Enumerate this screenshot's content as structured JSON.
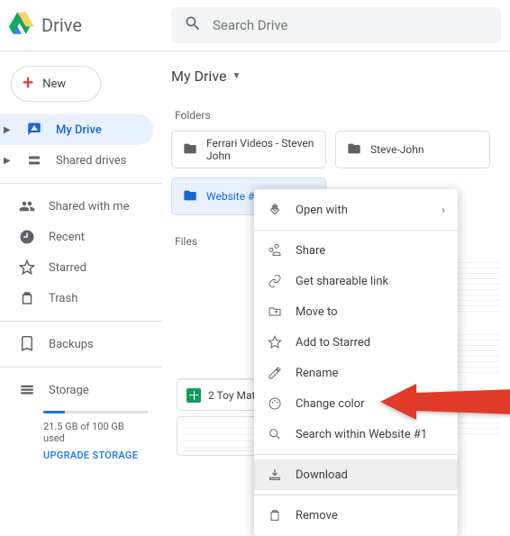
{
  "app_name": "Drive",
  "search": {
    "placeholder": "Search Drive"
  },
  "new_button": "New",
  "sidebar": {
    "items": [
      {
        "label": "My Drive"
      },
      {
        "label": "Shared drives"
      },
      {
        "label": "Shared with me"
      },
      {
        "label": "Recent"
      },
      {
        "label": "Starred"
      },
      {
        "label": "Trash"
      },
      {
        "label": "Backups"
      },
      {
        "label": "Storage"
      }
    ],
    "storage_used": "21.5 GB of 100 GB used",
    "upgrade": "UPGRADE STORAGE"
  },
  "breadcrumb": {
    "label": "My Drive"
  },
  "sections": {
    "folders_label": "Folders",
    "files_label": "Files"
  },
  "folders": [
    {
      "name": "Ferrari Videos - Steven John"
    },
    {
      "name": "Steve-John"
    },
    {
      "name": "Website #1"
    }
  ],
  "files": [
    {
      "name": "2 Toy Mat"
    }
  ],
  "context_menu": {
    "open_with": "Open with",
    "share": "Share",
    "get_link": "Get shareable link",
    "move_to": "Move to",
    "add_star": "Add to Starred",
    "rename": "Rename",
    "change_color": "Change color",
    "search_within": "Search within Website #1",
    "download": "Download",
    "remove": "Remove"
  }
}
